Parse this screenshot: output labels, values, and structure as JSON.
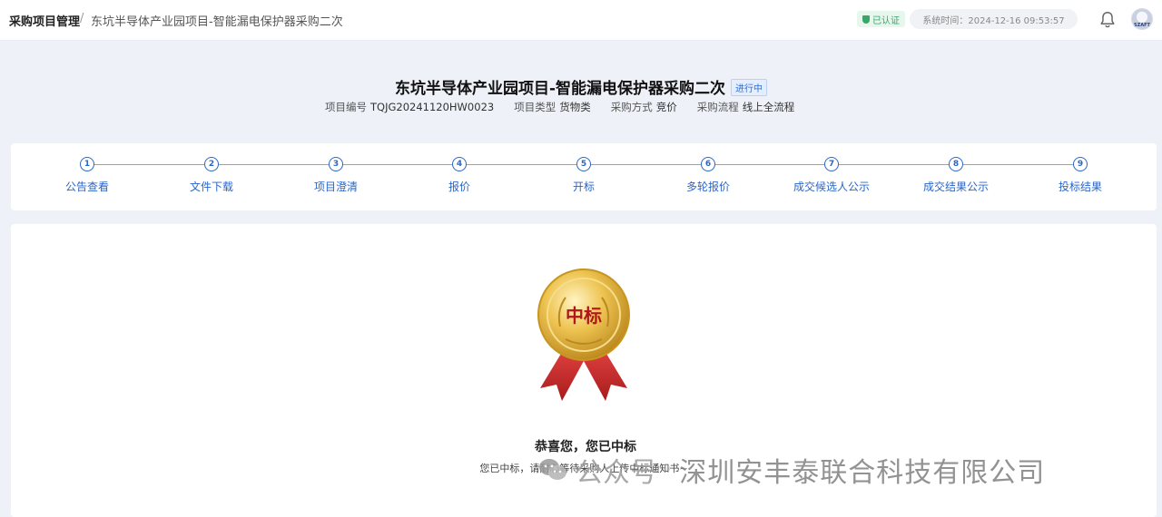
{
  "topbar": {
    "breadcrumb_root": "采购项目管理",
    "breadcrumb_sep": "/",
    "breadcrumb_current": "东坑半导体产业园项目-智能漏电保护器采购二次",
    "verified_label": "已认证",
    "system_time": "系统时间：2024-12-16 09:53:57",
    "avatar_text": "SZAFT"
  },
  "project": {
    "title": "东坑半导体产业园项目-智能漏电保护器采购二次",
    "status": "进行中",
    "meta": [
      {
        "key": "项目编号",
        "value": "TQJG20241120HW0023"
      },
      {
        "key": "项目类型",
        "value": "货物类"
      },
      {
        "key": "采购方式",
        "value": "竞价"
      },
      {
        "key": "采购流程",
        "value": "线上全流程"
      }
    ]
  },
  "steps": [
    {
      "num": "1",
      "label": "公告查看"
    },
    {
      "num": "2",
      "label": "文件下载"
    },
    {
      "num": "3",
      "label": "项目澄清"
    },
    {
      "num": "4",
      "label": "报价"
    },
    {
      "num": "5",
      "label": "开标"
    },
    {
      "num": "6",
      "label": "多轮报价"
    },
    {
      "num": "7",
      "label": "成交候选人公示"
    },
    {
      "num": "8",
      "label": "成交结果公示"
    },
    {
      "num": "9",
      "label": "投标结果"
    }
  ],
  "result": {
    "medal_text": "中标",
    "title": "恭喜您，您已中标",
    "message": "您已中标，请耐心等待采购人上传中标通知书~"
  },
  "watermark": {
    "label": "公众号",
    "dash": "·",
    "company": "深圳安丰泰联合科技有限公司"
  },
  "colors": {
    "accent": "#2b66c8",
    "verified": "#3aa66a",
    "medal_gold": "#d9a524",
    "medal_red": "#c62828"
  }
}
